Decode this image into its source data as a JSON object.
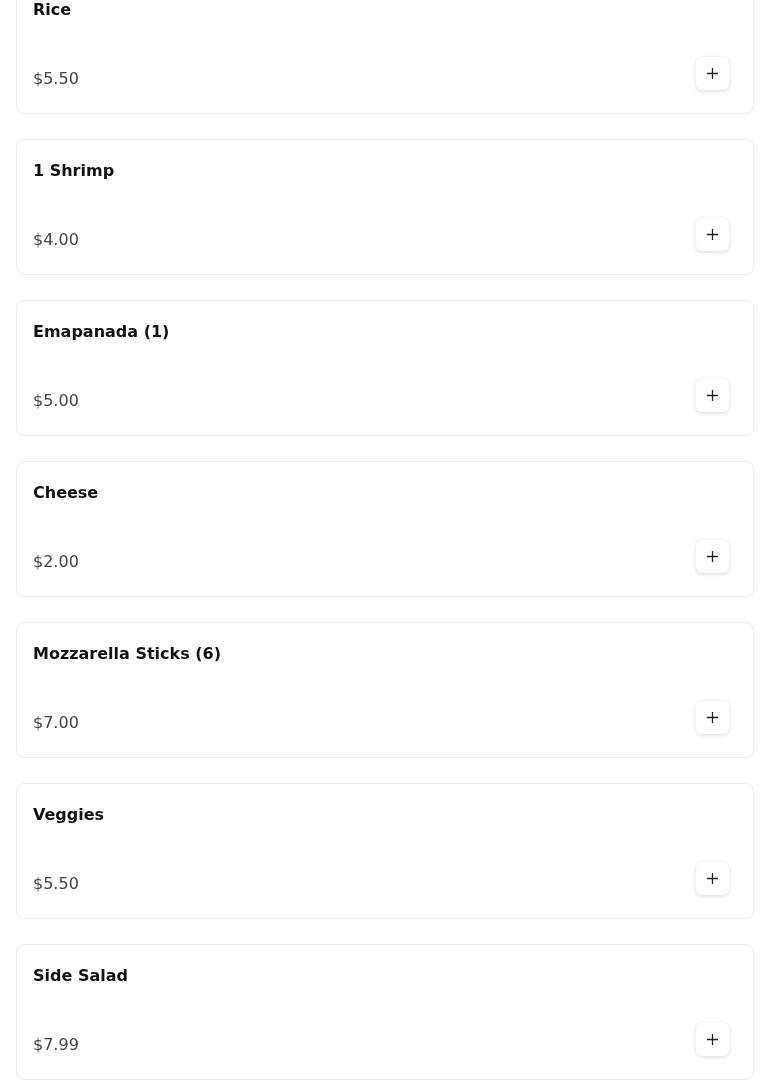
{
  "menu_items": [
    {
      "name": "Rice",
      "price": "$5.50"
    },
    {
      "name": "1 Shrimp",
      "price": "$4.00"
    },
    {
      "name": "Emapanada (1)",
      "price": "$5.00"
    },
    {
      "name": "Cheese",
      "price": "$2.00"
    },
    {
      "name": "Mozzarella Sticks (6)",
      "price": "$7.00"
    },
    {
      "name": "Veggies",
      "price": "$5.50"
    },
    {
      "name": "Side Salad",
      "price": "$7.99"
    }
  ]
}
